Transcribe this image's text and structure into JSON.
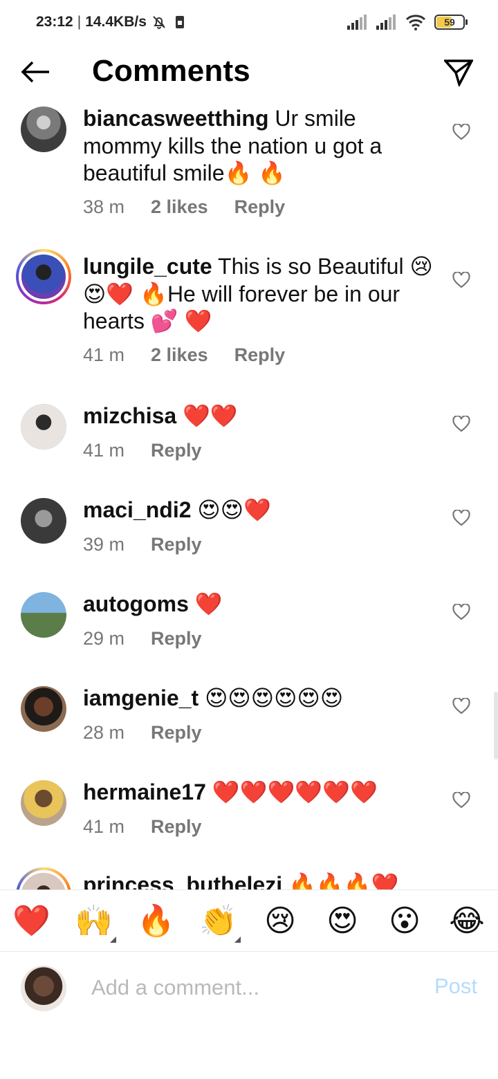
{
  "status_bar": {
    "time": "23:12",
    "network_speed": "14.4KB/s",
    "battery_percent": "59",
    "battery_level": 0.59,
    "icons": [
      "mute-icon",
      "sim-icon",
      "signal-icon",
      "signal-icon",
      "wifi-icon",
      "battery-icon"
    ]
  },
  "header": {
    "title": "Comments",
    "back_icon": "arrow-left-icon",
    "send_icon": "paper-plane-icon"
  },
  "comments": [
    {
      "username": "biancasweetthing",
      "text": "Ur smile mommy kills the nation u got a beautiful smile🔥 🔥",
      "time": "38 m",
      "likes": "2 likes",
      "reply": "Reply",
      "story_ring": false,
      "avatar_color": "#555555"
    },
    {
      "username": "lungile_cute",
      "text": "This is so Beautiful 😢😍❤️ 🔥He will forever be in our hearts 💕 ❤️",
      "time": "41 m",
      "likes": "2 likes",
      "reply": "Reply",
      "story_ring": true,
      "avatar_color": "#3b4fb8"
    },
    {
      "username": "mizchisa",
      "text": "❤️❤️",
      "time": "41 m",
      "likes": "",
      "reply": "Reply",
      "story_ring": false,
      "avatar_color": "#e9e4df"
    },
    {
      "username": "maci_ndi2",
      "text": "😍😍❤️",
      "time": "39 m",
      "likes": "",
      "reply": "Reply",
      "story_ring": false,
      "avatar_color": "#3a3a3a"
    },
    {
      "username": "autogoms",
      "text": "❤️",
      "time": "29 m",
      "likes": "",
      "reply": "Reply",
      "story_ring": false,
      "avatar_color": "#4a7fb5"
    },
    {
      "username": "iamgenie_t",
      "text": "😍😍😍😍😍😍",
      "time": "28 m",
      "likes": "",
      "reply": "Reply",
      "story_ring": false,
      "avatar_color": "#6b3e2a"
    },
    {
      "username": "hermaine17",
      "text": "❤️❤️❤️❤️❤️❤️",
      "time": "41 m",
      "likes": "",
      "reply": "Reply",
      "story_ring": false,
      "avatar_color": "#c79a52"
    },
    {
      "username": "princess_buthelezi",
      "text": "🔥🔥🔥❤️",
      "time": "",
      "likes": "",
      "reply": "",
      "story_ring": true,
      "avatar_color": "#d8c8c0"
    }
  ],
  "quick_reactions": [
    {
      "emoji": "❤️",
      "name": "red-heart-emoji",
      "has_variants": false
    },
    {
      "emoji": "🙌",
      "name": "raising-hands-emoji",
      "has_variants": true
    },
    {
      "emoji": "🔥",
      "name": "fire-emoji",
      "has_variants": false
    },
    {
      "emoji": "👏",
      "name": "clapping-hands-emoji",
      "has_variants": true
    },
    {
      "emoji": "😢",
      "name": "crying-face-emoji",
      "has_variants": false
    },
    {
      "emoji": "😍",
      "name": "heart-eyes-emoji",
      "has_variants": false
    },
    {
      "emoji": "😮",
      "name": "surprised-face-emoji",
      "has_variants": false
    },
    {
      "emoji": "😂",
      "name": "tears-of-joy-emoji",
      "has_variants": false
    }
  ],
  "composer": {
    "placeholder": "Add a comment...",
    "value": "",
    "post_label": "Post",
    "avatar_color": "#6b4a3a"
  },
  "colors": {
    "meta_text": "#777777",
    "post_disabled": "#b3dbff",
    "story_ring": "#d62976"
  }
}
